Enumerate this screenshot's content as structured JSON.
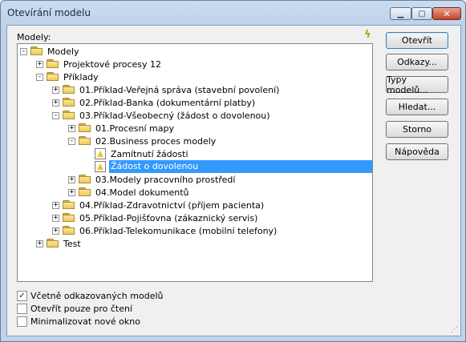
{
  "window": {
    "title": "Otevírání modelu",
    "minimize_glyph": "▁",
    "maximize_glyph": "▢",
    "close_glyph": "✕"
  },
  "models_label": "Modely:",
  "refresh_icon": "lightning-refresh-icon",
  "tree": [
    {
      "label": "Modely",
      "expander": "-",
      "icon": "folder"
    },
    {
      "label": "Projektové procesy 12",
      "expander": "+",
      "icon": "folder"
    },
    {
      "label": "Příklady",
      "expander": "-",
      "icon": "folder"
    },
    {
      "label": "01.Příklad-Veřejná správa (stavební povolení)",
      "expander": "+",
      "icon": "folder"
    },
    {
      "label": "02.Příklad-Banka (dokumentární platby)",
      "expander": "+",
      "icon": "folder"
    },
    {
      "label": "03.Příklad-Všeobecný (žádost o dovolenou)",
      "expander": "-",
      "icon": "folder"
    },
    {
      "label": "01.Procesní mapy",
      "expander": "+",
      "icon": "folder"
    },
    {
      "label": "02.Business proces modely",
      "expander": "-",
      "icon": "folder"
    },
    {
      "label": "Zamítnutí žádosti",
      "expander": "",
      "icon": "model"
    },
    {
      "label": "Žádost o dovolenou",
      "expander": "",
      "icon": "model",
      "selected": true
    },
    {
      "label": "03.Modely pracovního prostředí",
      "expander": "+",
      "icon": "folder"
    },
    {
      "label": "04.Model dokumentů",
      "expander": "+",
      "icon": "folder"
    },
    {
      "label": "04.Příklad-Zdravotnictví (příjem pacienta)",
      "expander": "+",
      "icon": "folder"
    },
    {
      "label": "05.Příklad-Pojišťovna (zákaznický servis)",
      "expander": "+",
      "icon": "folder"
    },
    {
      "label": "06.Příklad-Telekomunikace (mobilní telefony)",
      "expander": "+",
      "icon": "folder"
    },
    {
      "label": "Test",
      "expander": "+",
      "icon": "folder"
    }
  ],
  "buttons": {
    "open": "Otevřít",
    "links": "Odkazy...",
    "model_types": "Typy modelů...",
    "search": "Hledat...",
    "cancel": "Storno",
    "help": "Nápověda"
  },
  "options": [
    {
      "label": "Včetně odkazovaných modelů",
      "checked": true,
      "mark": "✓"
    },
    {
      "label": "Otevřít pouze pro čtení",
      "checked": false,
      "mark": ""
    },
    {
      "label": "Minimalizovat nové okno",
      "checked": false,
      "mark": ""
    }
  ],
  "resize_grip": "resize-grip-icon"
}
